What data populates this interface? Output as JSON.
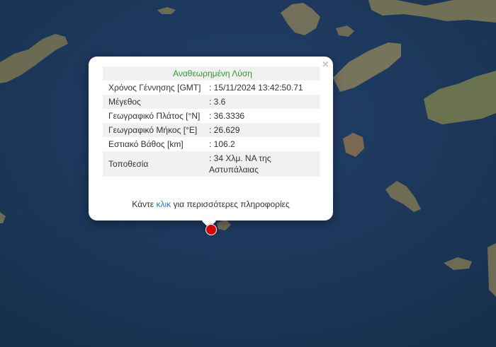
{
  "popup": {
    "header": "Αναθεωρημένη Λύση",
    "rows": [
      {
        "label": "Χρόνος Γέννησης [GMT]",
        "value": ": 15/11/2024 13:42:50.71"
      },
      {
        "label": "Μέγεθος",
        "value": ": 3.6"
      },
      {
        "label": "Γεωγραφικό Πλάτος [°N]",
        "value": ": 36.3336"
      },
      {
        "label": "Γεωγραφικό Μήκος [°E]",
        "value": ": 26.629"
      },
      {
        "label": "Εστιακό Βάθος [km]",
        "value": ": 106.2"
      },
      {
        "label": "Τοποθεσία",
        "value": ": 34 Χλμ. ΝΑ της Αστυπάλαιας"
      }
    ],
    "more_prefix": "Κάντε",
    "more_link": "κλικ",
    "more_suffix": "για περισσότερες πληροφορίες",
    "close_label": "×"
  },
  "colors": {
    "sea": "#1c3452",
    "land": "#6b6a52",
    "marker": "#d40000",
    "header_text": "#2e9a2e",
    "link": "#2a7bbf"
  }
}
